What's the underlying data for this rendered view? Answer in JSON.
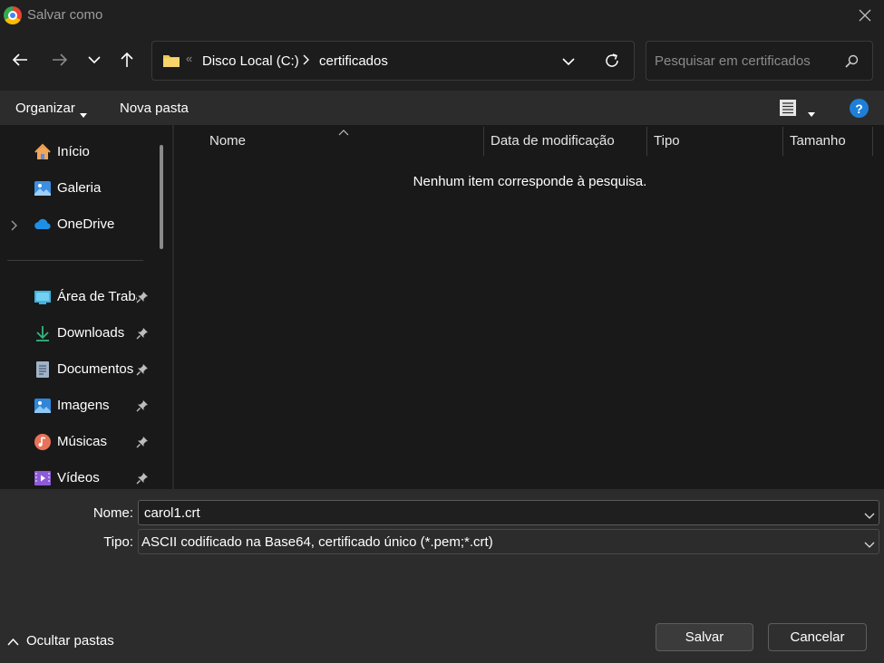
{
  "window": {
    "title": "Salvar como"
  },
  "address": {
    "crumbs": [
      "Disco Local (C:)",
      "certificados"
    ]
  },
  "search": {
    "placeholder": "Pesquisar em certificados"
  },
  "commands": {
    "organize": "Organizar",
    "new_folder": "Nova pasta",
    "help": "?"
  },
  "nav": {
    "top": [
      {
        "label": "Início",
        "icon": "home-icon"
      },
      {
        "label": "Galeria",
        "icon": "gallery-icon"
      },
      {
        "label": "OneDrive",
        "icon": "cloud-icon"
      }
    ],
    "quick": [
      {
        "label": "Área de Trabalho",
        "icon": "desktop-icon"
      },
      {
        "label": "Downloads",
        "icon": "download-icon"
      },
      {
        "label": "Documentos",
        "icon": "documents-icon"
      },
      {
        "label": "Imagens",
        "icon": "pictures-icon"
      },
      {
        "label": "Músicas",
        "icon": "music-icon"
      },
      {
        "label": "Vídeos",
        "icon": "videos-icon"
      }
    ]
  },
  "list": {
    "columns": [
      "Nome",
      "Data de modificação",
      "Tipo",
      "Tamanho"
    ],
    "empty_message": "Nenhum item corresponde à pesquisa."
  },
  "form": {
    "name_label": "Nome:",
    "name_value": "carol1.crt",
    "type_label": "Tipo:",
    "type_value": "ASCII codificado na Base64, certificado único (*.pem;*.crt)"
  },
  "footer": {
    "hide_folders": "Ocultar pastas",
    "save": "Salvar",
    "cancel": "Cancelar"
  },
  "colors": {
    "accent": "#1e7fd8",
    "folder": "#f3c64a"
  }
}
